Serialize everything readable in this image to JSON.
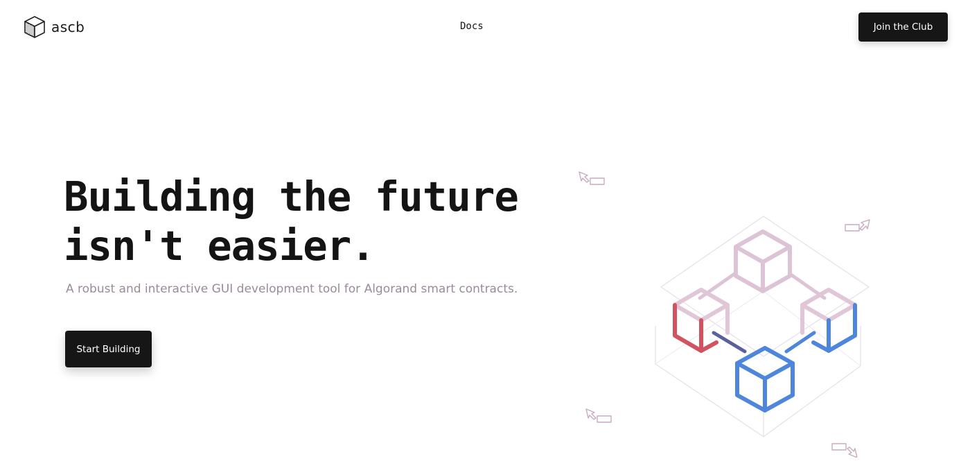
{
  "header": {
    "logo_text": "ascb",
    "nav": {
      "docs_label": "Docs"
    },
    "cta_label": "Join the Club"
  },
  "hero": {
    "title_line1": "Building the future",
    "title_line2_prefix": "isn't ",
    "title_highlight": "easier",
    "title_suffix": ".",
    "subtitle": "A robust and interactive GUI development tool for Algorand smart contracts.",
    "cta_label": "Start Building"
  },
  "colors": {
    "text_dark": "#151515",
    "button_bg": "#161616",
    "subtitle": "#9a8a9a",
    "accent_red": "#d2525f",
    "accent_blue": "#4d86dc",
    "accent_pink": "#d9bcd0"
  },
  "illustration": {
    "icons": [
      "cube-logo-icon",
      "isometric-cubes-illustration",
      "cursor-arrow-icon"
    ]
  }
}
